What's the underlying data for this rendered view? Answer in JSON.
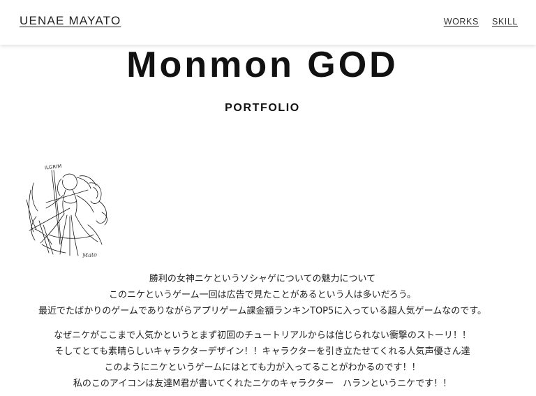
{
  "header": {
    "brand": "UENAE MAYATO",
    "nav": [
      {
        "label": "WORKS"
      },
      {
        "label": "SKILL"
      }
    ]
  },
  "hero": {
    "title": "Monmon GOD",
    "subtitle": "PORTFOLIO"
  },
  "illustration": {
    "caption": "ILGRIM",
    "signature": "Mato"
  },
  "description": {
    "paragraph1": [
      "勝利の女神ニケというソシャゲについての魅力について",
      "このニケというゲーム一回は広告で見たことがあるという人は多いだろう。",
      "最近でたばかりのゲームでありながらアプリゲーム課金額ランキンTOP5に入っている超人気ゲームなのです。"
    ],
    "paragraph2": [
      "なぜニケがここまで人気かというとまず初回のチュートリアルからは信じられない衝撃のストーリ！！",
      "そしてとても素晴らしいキャラクターデザイン！！キャラクターを引き立たせてくれる人気声優さん達",
      "このようにニケというゲームにはとても力が入ってることがわかるのです！！",
      "私のこのアイコンは友達M君が書いてくれたニケのキャラクター　ハランというニケです！！"
    ]
  }
}
